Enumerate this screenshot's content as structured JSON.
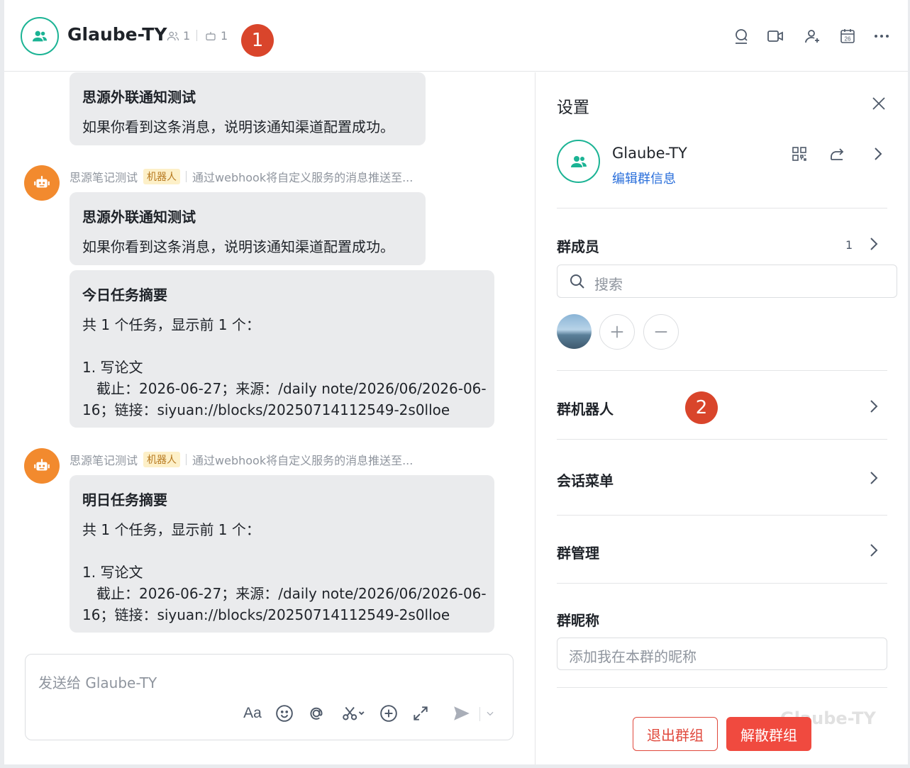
{
  "header": {
    "title": "Glaube-TY",
    "member_count": "1",
    "bot_count": "1",
    "badge1": "1",
    "calendar_day": "26"
  },
  "messages": [
    {
      "title": "思源外联通知测试",
      "lines": [
        "如果你看到这条消息，说明该通知渠道配置成功。"
      ]
    },
    {
      "sender": "思源笔记测试",
      "tag": "机器人",
      "desc": "通过webhook将自定义服务的消息推送至...",
      "title": "思源外联通知测试",
      "lines": [
        "如果你看到这条消息，说明该通知渠道配置成功。"
      ]
    },
    {
      "title": "今日任务摘要",
      "lines": [
        "共 1 个任务，显示前 1 个：",
        "1. 写论文",
        "截止：2026-06-27；来源：/daily note/2026/06/2026-06-",
        "16；链接：siyuan://blocks/20250714112549-2s0lloe"
      ]
    },
    {
      "sender": "思源笔记测试",
      "tag": "机器人",
      "desc": "通过webhook将自定义服务的消息推送至...",
      "title": "明日任务摘要",
      "lines": [
        "共 1 个任务，显示前 1 个：",
        "1. 写论文",
        "截止：2026-06-27；来源：/daily note/2026/06/2026-06-",
        "16；链接：siyuan://blocks/20250714112549-2s0lloe"
      ]
    }
  ],
  "composer": {
    "placeholder": "发送给 Glaube-TY",
    "font_label": "Aa"
  },
  "settings": {
    "title": "设置",
    "group_name": "Glaube-TY",
    "edit_info": "编辑群信息",
    "members_label": "群成员",
    "members_count": "1",
    "search_placeholder": "搜索",
    "bots_label": "群机器人",
    "badge2": "2",
    "menu_label": "会话菜单",
    "manage_label": "群管理",
    "nickname_label": "群昵称",
    "nickname_placeholder": "添加我在本群的昵称",
    "exit_label": "退出群组",
    "dissolve_label": "解散群组",
    "watermark": "Glaube-TY"
  },
  "colors": {
    "accent": "#1bb394",
    "badge": "#d9452b",
    "danger": "#f04a3f",
    "link": "#2a6fdb",
    "bot_avatar": "#f28a2e"
  }
}
